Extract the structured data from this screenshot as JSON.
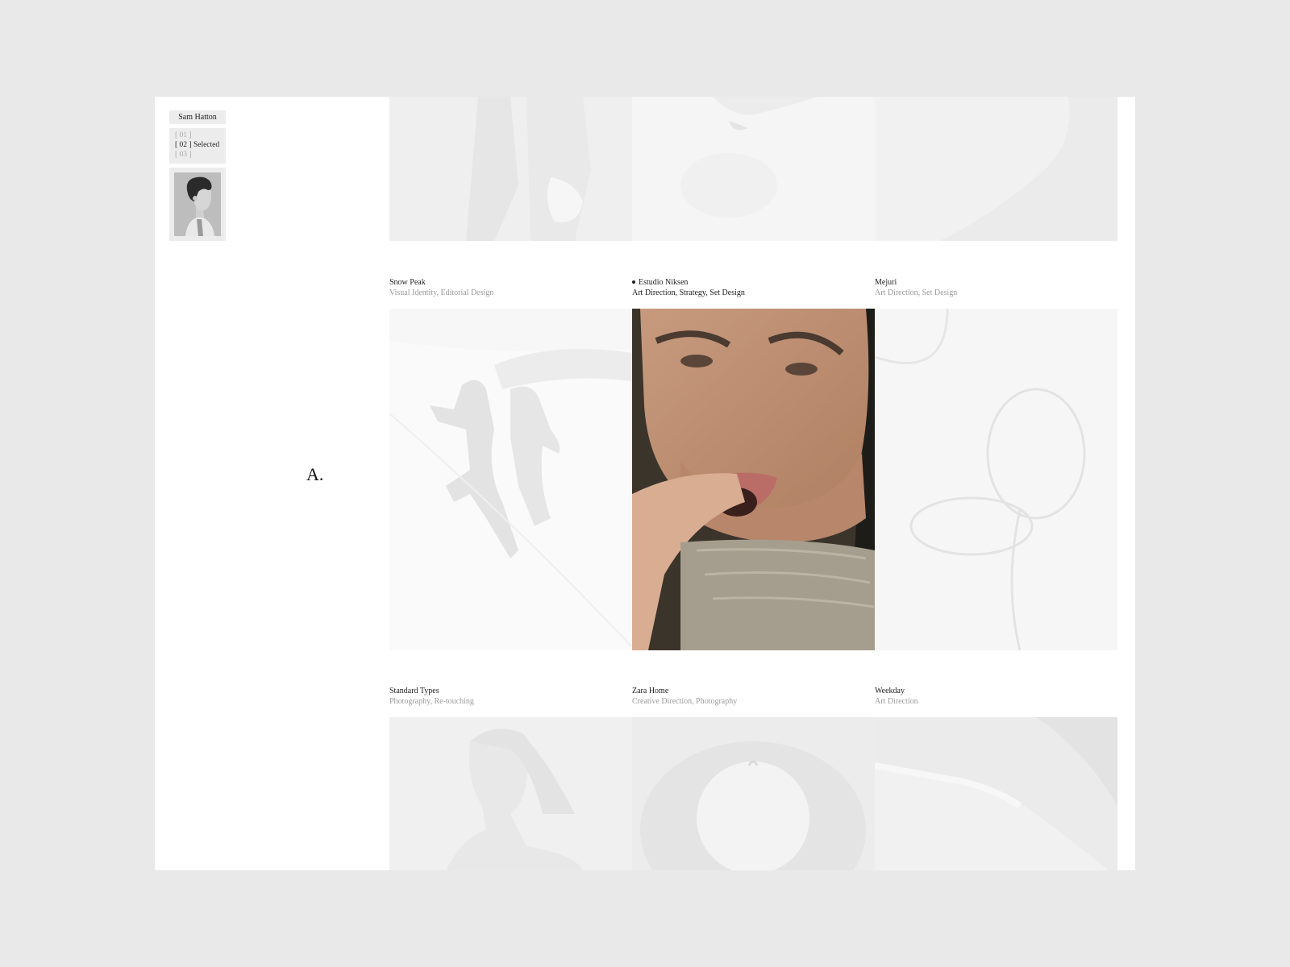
{
  "sidebar": {
    "name": "Sam Hatton",
    "nav": [
      {
        "num": "[ 01 ]",
        "label": ""
      },
      {
        "num": "[ 02 ]",
        "label": "Selected"
      },
      {
        "num": "[ 03 ]",
        "label": ""
      }
    ],
    "active_index": 1,
    "monogram": "A."
  },
  "projects": [
    {
      "title": "Snow Peak",
      "services": "Visual Identity, Editorial Design",
      "active": false,
      "image": "snow-landscape-figures"
    },
    {
      "title": "Estudio Niksen",
      "services": "Art Direction, Strategy, Set Design",
      "active": true,
      "image": "woman-biting-chocolate"
    },
    {
      "title": "Mejuri",
      "services": "Art Direction, Set Design",
      "active": false,
      "image": "silver-chain-loops"
    },
    {
      "title": "Standard Types",
      "services": "Photography, Re-touching",
      "active": false,
      "image": "woman-portrait"
    },
    {
      "title": "Zara Home",
      "services": "Creative Direction, Photography",
      "active": false,
      "image": "white-fruit-bowl"
    },
    {
      "title": "Weekday",
      "services": "Art Direction",
      "active": false,
      "image": "sunglasses-closeup"
    }
  ],
  "top_row_images": [
    "person-holding-paper",
    "hand-with-cloth",
    "shoulder-closeup"
  ],
  "colors": {
    "page_bg": "#e9e9e9",
    "frame_bg": "#ffffff",
    "muted_text": "#9a9a9a",
    "text": "#222222"
  }
}
